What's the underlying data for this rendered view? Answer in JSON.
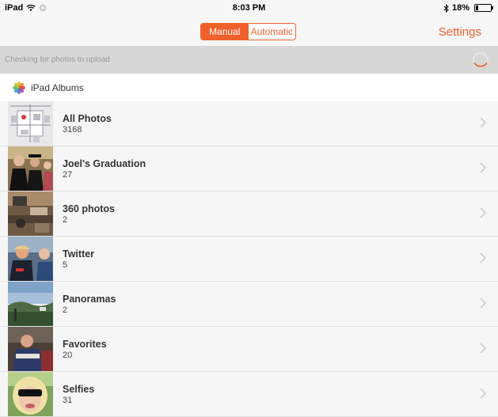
{
  "status_bar": {
    "device": "iPad",
    "time": "8:03 PM",
    "battery": "18%",
    "battery_level": 0.18
  },
  "nav": {
    "segments": [
      "Manual",
      "Automatic"
    ],
    "selected": "Manual",
    "settings_label": "Settings"
  },
  "upload_status": {
    "text": "Checking for photos to upload"
  },
  "section": {
    "title": "iPad Albums"
  },
  "albums": [
    {
      "name": "All Photos",
      "count": "3168"
    },
    {
      "name": "Joel's Graduation",
      "count": "27"
    },
    {
      "name": "360 photos",
      "count": "2"
    },
    {
      "name": "Twitter",
      "count": "5"
    },
    {
      "name": "Panoramas",
      "count": "2"
    },
    {
      "name": "Favorites",
      "count": "20"
    },
    {
      "name": "Selfies",
      "count": "31"
    }
  ],
  "colors": {
    "accent": "#f0602c",
    "list_bg": "#f6f6f6",
    "upload_bg": "#d7d7d7"
  }
}
